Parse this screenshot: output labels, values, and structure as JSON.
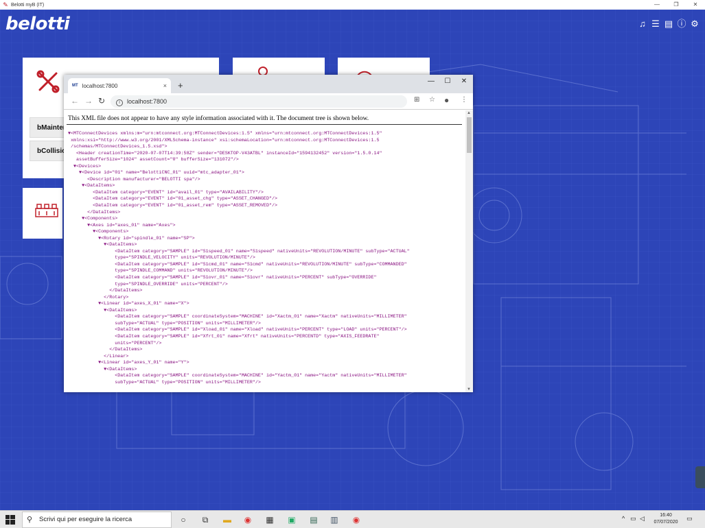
{
  "window": {
    "title": "Belotti myB (IT)",
    "minimize_glyph": "—",
    "maximize_glyph": "❐",
    "close_glyph": "✕"
  },
  "app": {
    "logo_text": "belotti",
    "top_icons": [
      "bell-icon",
      "list-icon",
      "document-icon",
      "info-icon",
      "gear-icon"
    ],
    "cards": [
      {
        "rows": [
          "bMaintenance",
          "bCollision"
        ]
      }
    ],
    "colors": {
      "background": "#2d45b8",
      "accent": "#c0202a"
    }
  },
  "browser": {
    "tab_favicon": "MT",
    "tab_title": "localhost:7800",
    "tab_close": "×",
    "new_tab": "+",
    "url": "localhost:7800",
    "xml_notice": "This XML file does not appear to have any style information associated with it. The document tree is shown below.",
    "xml_lines": [
      "▼<MTConnectDevices xmlns:m=\"urn:mtconnect.org:MTConnectDevices:1.5\" xmlns=\"urn:mtconnect.org:MTConnectDevices:1.5\"",
      " xmlns:xsi=\"http://www.w3.org/2001/XMLSchema-instance\" xsi:schemaLocation=\"urn:mtconnect.org:MTConnectDevices:1.5",
      " /schemas/MTConnectDevices_1.5.xsd\">",
      "   <Header creationTime=\"2020-07-07T14:39:58Z\" sender=\"DESKTOP-V43ATBL\" instanceId=\"1594132452\" version=\"1.5.0.14\"",
      "   assetBufferSize=\"1024\" assetCount=\"0\" bufferSize=\"131072\"/>",
      "  ▼<Devices>",
      "    ▼<Device id=\"01\" name=\"BelottiCNC_01\" uuid=\"mtc_adapter_01\">",
      "       <Description manufacturer=\"BELOTTI spa\"/>",
      "     ▼<DataItems>",
      "         <DataItem category=\"EVENT\" id=\"avail_01\" type=\"AVAILABILITY\"/>",
      "         <DataItem category=\"EVENT\" id=\"01_asset_chg\" type=\"ASSET_CHANGED\"/>",
      "         <DataItem category=\"EVENT\" id=\"01_asset_rem\" type=\"ASSET_REMOVED\"/>",
      "       </DataItems>",
      "     ▼<Components>",
      "       ▼<Axes id=\"axes_01\" name=\"Axes\">",
      "         ▼<Components>",
      "           ▼<Rotary id=\"spindle_01\" name=\"SP\">",
      "             ▼<DataItems>",
      "                 <DataItem category=\"SAMPLE\" id=\"S1speed_01\" name=\"S1speed\" nativeUnits=\"REVOLUTION/MINUTE\" subType=\"ACTUAL\"",
      "                 type=\"SPINDLE_VELOCITY\" units=\"REVOLUTION/MINUTE\"/>",
      "                 <DataItem category=\"SAMPLE\" id=\"S1cmd_01\" name=\"S1cmd\" nativeUnits=\"REVOLUTION/MINUTE\" subType=\"COMMANDED\"",
      "                 type=\"SPINDLE_COMMAND\" units=\"REVOLUTION/MINUTE\"/>",
      "                 <DataItem category=\"SAMPLE\" id=\"S1ovr_01\" name=\"S1ovr\" nativeUnits=\"PERCENT\" subType=\"OVERRIDE\"",
      "                 type=\"SPINDLE_OVERRIDE\" units=\"PERCENT\"/>",
      "               </DataItems>",
      "             </Rotary>",
      "           ▼<Linear id=\"axes_X_01\" name=\"X\">",
      "             ▼<DataItems>",
      "                 <DataItem category=\"SAMPLE\" coordinateSystem=\"MACHINE\" id=\"Xactm_01\" name=\"Xactm\" nativeUnits=\"MILLIMETER\"",
      "                 subType=\"ACTUAL\" type=\"POSITION\" units=\"MILLIMETER\"/>",
      "                 <DataItem category=\"SAMPLE\" id=\"Xload_01\" name=\"Xload\" nativeUnits=\"PERCENT\" type=\"LOAD\" units=\"PERCENT\"/>",
      "                 <DataItem category=\"SAMPLE\" id=\"Xfrt_01\" name=\"Xfrt\" nativeUnits=\"PERCENTD\" type=\"AXIS_FEEDRATE\"",
      "                 units=\"PERCENT\"/>",
      "               </DataItems>",
      "             </Linear>",
      "           ▼<Linear id=\"axes_Y_01\" name=\"Y\">",
      "             ▼<DataItems>",
      "                 <DataItem category=\"SAMPLE\" coordinateSystem=\"MACHINE\" id=\"Yactm_01\" name=\"Yactm\" nativeUnits=\"MILLIMETER\"",
      "                 subType=\"ACTUAL\" type=\"POSITION\" units=\"MILLIMETER\"/>"
    ]
  },
  "taskbar": {
    "search_placeholder": "Scrivi qui per eseguire la ricerca",
    "time": "16:40",
    "date": "07/07/2020"
  }
}
